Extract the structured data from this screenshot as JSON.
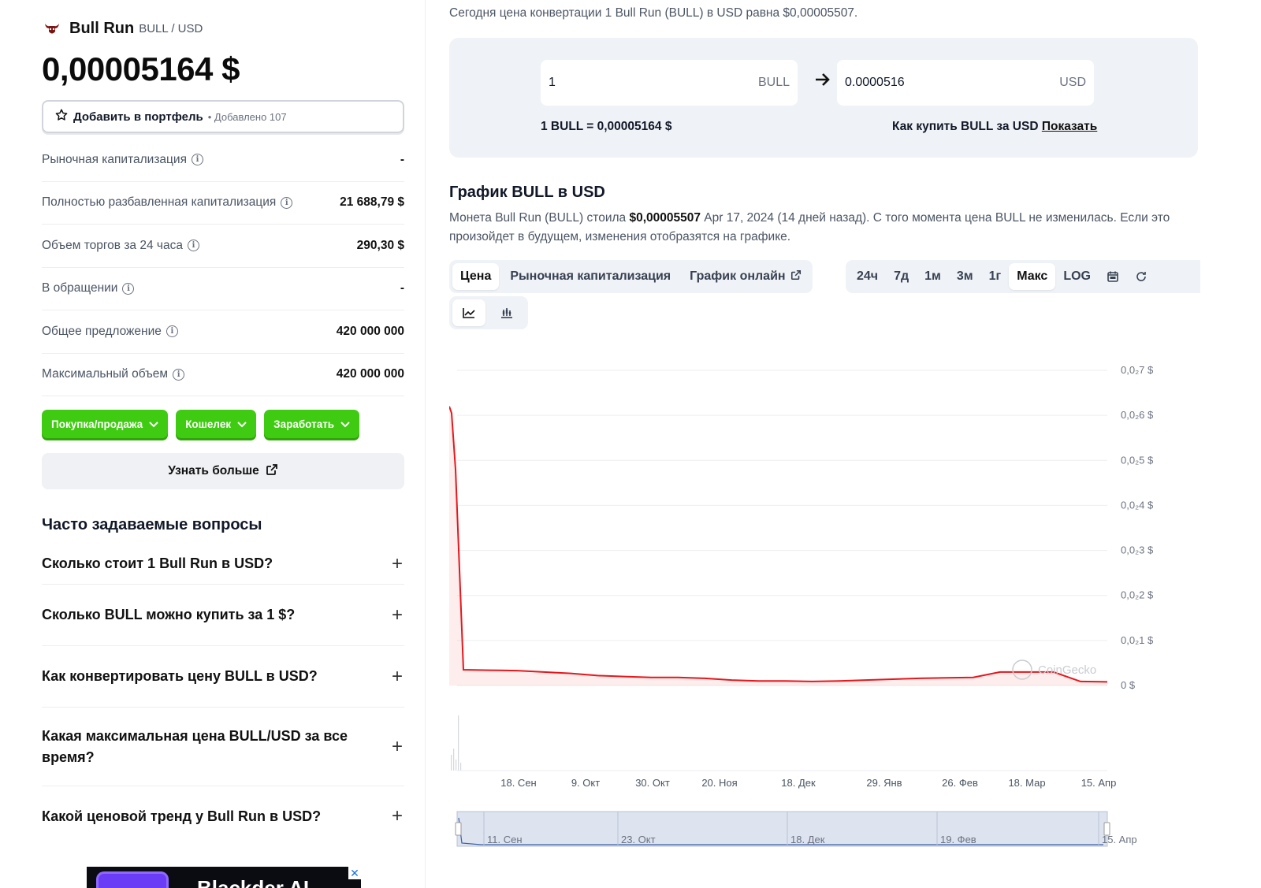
{
  "coin": {
    "name": "Bull Run",
    "pair": "BULL / USD",
    "price": "0,00005164 $",
    "portfolio_label": "Добавить в портфель",
    "portfolio_added": "• Добавлено 107"
  },
  "stats": [
    {
      "label": "Рыночная капитализация",
      "value": "-"
    },
    {
      "label": "Полностью разбавленная капитализация",
      "value": "21 688,79 $"
    },
    {
      "label": "Объем торгов за 24 часа",
      "value": "290,30 $"
    },
    {
      "label": "В обращении",
      "value": "-"
    },
    {
      "label": "Общее предложение",
      "value": "420 000 000"
    },
    {
      "label": "Максимальный объем",
      "value": "420 000 000"
    }
  ],
  "actions": {
    "buy_sell": "Покупка/продажа",
    "wallet": "Кошелек",
    "earn": "Заработать",
    "learn_more": "Узнать больше"
  },
  "faq": {
    "title": "Часто задаваемые вопросы",
    "items": [
      "Сколько стоит 1 Bull Run в USD?",
      "Сколько BULL можно купить за 1 $?",
      "Как конвертировать цену BULL в USD?",
      "Какая максимальная цена BULL/USD за все время?",
      "Какой ценовой тренд у Bull Run в USD?"
    ]
  },
  "ad": {
    "text": "Blackder AI"
  },
  "converter": {
    "note": "Сегодня цена конвертации 1 Bull Run (BULL) в USD равна $0,00005507.",
    "from_value": "1",
    "from_unit": "BULL",
    "to_value": "0.0000516",
    "to_unit": "USD",
    "rate": "1 BULL = 0,00005164 $",
    "how_to_buy": "Как купить BULL за USD",
    "show": "Показать"
  },
  "chart_section": {
    "title": "График BULL в USD",
    "desc_1": "Монета Bull Run (BULL) стоила ",
    "desc_price": "$0,00005507",
    "desc_2": " Apr 17, 2024 (14 дней назад). С того момента цена BULL не изменилась. Если это произойдет в будущем, изменения отобразятся на графике.",
    "tabs": [
      "Цена",
      "Рыночная капитализация",
      "График онлайн"
    ],
    "ranges": [
      "24ч",
      "7д",
      "1м",
      "3м",
      "1г",
      "Макс",
      "LOG"
    ],
    "active_range": "Макс",
    "watermark": "CoinGecko"
  },
  "chart_data": {
    "type": "line",
    "series": [
      {
        "values": [
          6.2e-05,
          6.05e-05,
          4.8e-05,
          3.5e-06,
          3.4e-06,
          3.3e-06,
          3e-06,
          2.7e-06,
          2.2e-06,
          2e-06,
          1.8e-06,
          1.8e-06,
          1.6e-06,
          1.2e-06,
          1e-06,
          1e-06,
          9e-07,
          1e-06,
          1.2e-06,
          1.4e-06,
          1.6e-06,
          1.7e-06,
          1.8e-06,
          3e-06,
          3e-06,
          3e-06,
          9e-07,
          8e-07
        ]
      }
    ],
    "x_ticks": [
      "18. Сен",
      "9. Окт",
      "30. Окт",
      "20. Ноя",
      "18. Дек",
      "29. Янв",
      "26. Фев",
      "18. Мар",
      "15. Апр"
    ],
    "y_ticks": [
      "0,0₂7 $",
      "0,0₂6 $",
      "0,0₂5 $",
      "0,0₂4 $",
      "0,0₂3 $",
      "0,0₂2 $",
      "0,0₂1 $",
      "0 $"
    ],
    "ylim": [
      0,
      7e-05
    ],
    "color": "#e8161b",
    "navigator_ticks": [
      "11. Сен",
      "23. Окт",
      "18. Дек",
      "19. Фев",
      "15. Апр"
    ]
  }
}
